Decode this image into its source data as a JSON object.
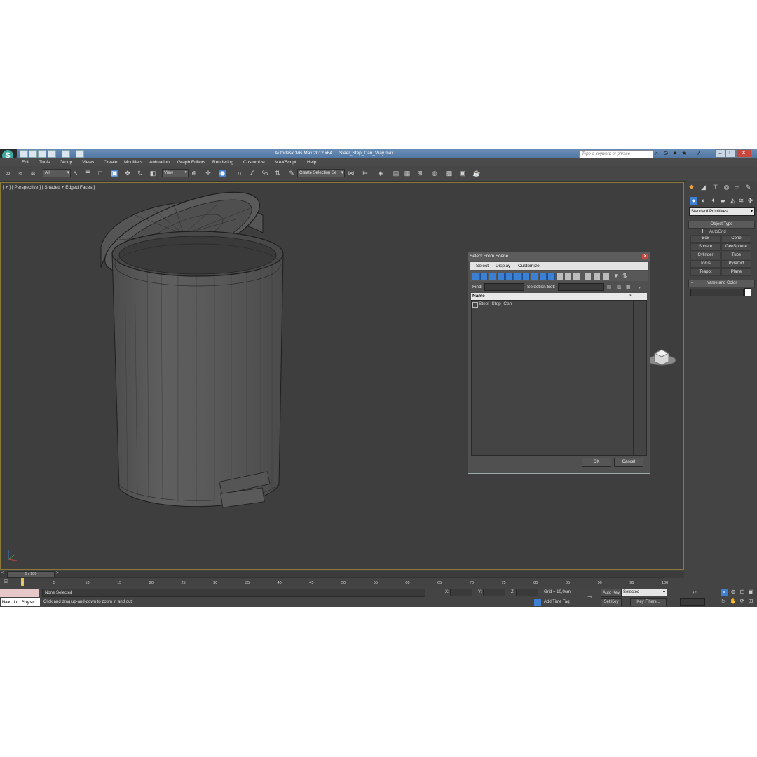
{
  "window": {
    "app_title": "Autodesk 3ds Max  2012 x64",
    "document": "Steel_Step_Can_Vray.max",
    "search_placeholder": "Type a keyword or phrase"
  },
  "menu": [
    "Edit",
    "Tools",
    "Group",
    "Views",
    "Create",
    "Modifiers",
    "Animation",
    "Graph Editors",
    "Rendering",
    "Customize",
    "MAXScript",
    "Help"
  ],
  "toolbar": {
    "filter_value": "All",
    "ref_coord_value": "View",
    "selection_set_value": "Create Selection Se"
  },
  "viewport": {
    "label": "[ + ] [ Perspective ] [ Shaded + Edged Faces ]"
  },
  "command_panel": {
    "category_value": "Standard Primitives",
    "object_type_title": "Object Type",
    "autogrid_label": "AutoGrid",
    "primitives": [
      "Box",
      "Cone",
      "Sphere",
      "GeoSphere",
      "Cylinder",
      "Tube",
      "Torus",
      "Pyramid",
      "Teapot",
      "Plane"
    ],
    "name_color_title": "Name and Color"
  },
  "dialog": {
    "title": "Select From Scene",
    "menu": [
      "Select",
      "Display",
      "Customize"
    ],
    "find_label": "Find:",
    "selection_set_label": "Selection Set:",
    "column_name": "Name",
    "rows": [
      "Steel_Step_Can"
    ],
    "ok_label": "OK",
    "cancel_label": "Cancel"
  },
  "timeline": {
    "frame_indicator": "0 / 100",
    "ticks": [
      "0",
      "5",
      "10",
      "15",
      "20",
      "25",
      "30",
      "35",
      "40",
      "45",
      "50",
      "55",
      "60",
      "65",
      "70",
      "75",
      "80",
      "85",
      "90",
      "95",
      "100"
    ]
  },
  "status": {
    "script_listener": "Max to Physc.",
    "selection": "None Selected",
    "hint": "Click and drag up-and-down to zoom in and out",
    "x_label": "X:",
    "y_label": "Y:",
    "z_label": "Z:",
    "grid": "Grid = 10,0cm",
    "add_time_tag": "Add Time Tag",
    "auto_key": "Auto Key",
    "set_key": "Set Key",
    "key_mode_value": "Selected",
    "key_filters": "Key Filters..."
  },
  "colors": {
    "viewport_border": "#8a7a38",
    "active_blue": "#3f7fd0",
    "title_blue": "#5a80ab"
  }
}
